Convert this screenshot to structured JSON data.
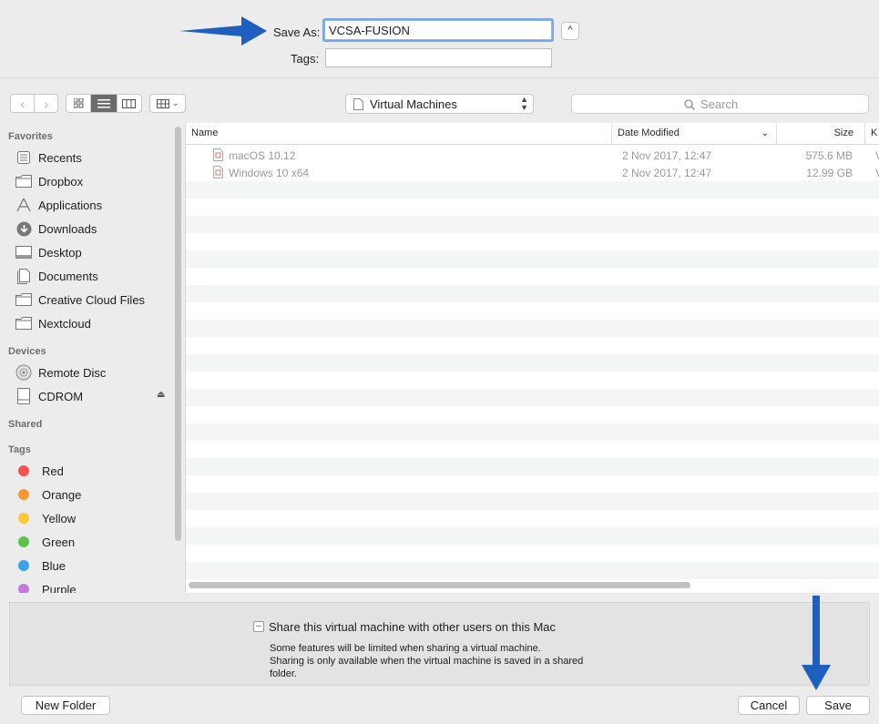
{
  "save": {
    "save_as_label": "Save As:",
    "save_as_value": "VCSA-FUSION",
    "tags_label": "Tags:",
    "tags_value": ""
  },
  "toolbar": {
    "location": "Virtual Machines",
    "search_placeholder": "Search"
  },
  "sidebar": {
    "favorites_header": "Favorites",
    "favorites": [
      {
        "label": "Recents",
        "icon": "recents-icon"
      },
      {
        "label": "Dropbox",
        "icon": "folder-icon"
      },
      {
        "label": "Applications",
        "icon": "applications-icon"
      },
      {
        "label": "Downloads",
        "icon": "downloads-icon"
      },
      {
        "label": "Desktop",
        "icon": "desktop-icon"
      },
      {
        "label": "Documents",
        "icon": "documents-icon"
      },
      {
        "label": "Creative Cloud Files",
        "icon": "folder-icon"
      },
      {
        "label": "Nextcloud",
        "icon": "folder-icon"
      }
    ],
    "devices_header": "Devices",
    "devices": [
      {
        "label": "Remote Disc",
        "icon": "disc-icon"
      },
      {
        "label": "CDROM",
        "icon": "drive-icon"
      }
    ],
    "shared_header": "Shared",
    "tags_header": "Tags",
    "tags": [
      {
        "label": "Red",
        "color": "#f4524c"
      },
      {
        "label": "Orange",
        "color": "#f59a33"
      },
      {
        "label": "Yellow",
        "color": "#f7c934"
      },
      {
        "label": "Green",
        "color": "#5ac247"
      },
      {
        "label": "Blue",
        "color": "#3aa1ef"
      },
      {
        "label": "Purple",
        "color": "#c27ad9"
      }
    ]
  },
  "list": {
    "columns": {
      "name": "Name",
      "date": "Date Modified",
      "size": "Size",
      "kind": "K"
    },
    "rows": [
      {
        "name": "macOS 10.12",
        "date": "2 Nov 2017, 12:47",
        "size": "575.6 MB",
        "kind": "V"
      },
      {
        "name": "Windows 10 x64",
        "date": "2 Nov 2017, 12:47",
        "size": "12.99 GB",
        "kind": "V"
      }
    ]
  },
  "accessory": {
    "share_label": "Share this virtual machine with other users on this Mac",
    "note_line1": "Some features will be limited when sharing a virtual machine.",
    "note_line2": "Sharing is only available when the virtual machine is saved in a shared",
    "note_line3": "folder."
  },
  "buttons": {
    "new_folder": "New Folder",
    "cancel": "Cancel",
    "save": "Save"
  },
  "colors": {
    "accent_focus": "#7aa7e9",
    "annotation_arrow": "#1f5fbf"
  }
}
